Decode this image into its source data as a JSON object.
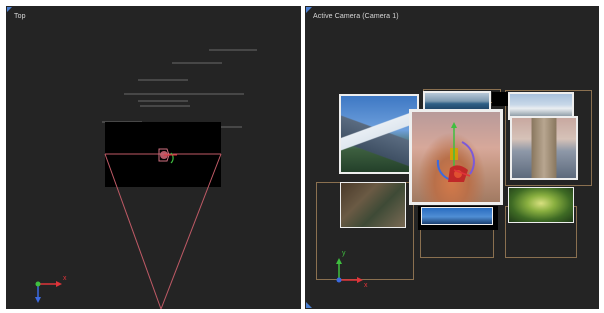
{
  "viewports": {
    "top": {
      "label": "Top"
    },
    "camera": {
      "label": "Active Camera (Camera 1)"
    }
  },
  "axes": {
    "x_label": "x",
    "y_label": "y",
    "z_label": "z"
  },
  "colors": {
    "viewport_bg": "#242424",
    "frustum": "#c05a66",
    "grid_lines": "#6a6a6a",
    "frame_outline": "#8a7050",
    "photo_border": "#eeeeee",
    "axis_x": "#e0343a",
    "axis_y": "#3fbf3f",
    "axis_z": "#3b6ae0",
    "corner_marker": "#4a7fd0"
  },
  "photos": [
    {
      "name": "photo-mountain",
      "subject": "snowy mountain landscape"
    },
    {
      "name": "photo-sea",
      "subject": "sea horizon"
    },
    {
      "name": "photo-snowy-hills",
      "subject": "snowy hills"
    },
    {
      "name": "photo-pier",
      "subject": "wooden pier at sunset"
    },
    {
      "name": "photo-desert-gizmo",
      "subject": "desert sunset with 3D gizmo"
    },
    {
      "name": "photo-forest",
      "subject": "forest"
    },
    {
      "name": "photo-ocean-sky",
      "subject": "ocean and sky"
    },
    {
      "name": "photo-valley",
      "subject": "green valley"
    }
  ]
}
